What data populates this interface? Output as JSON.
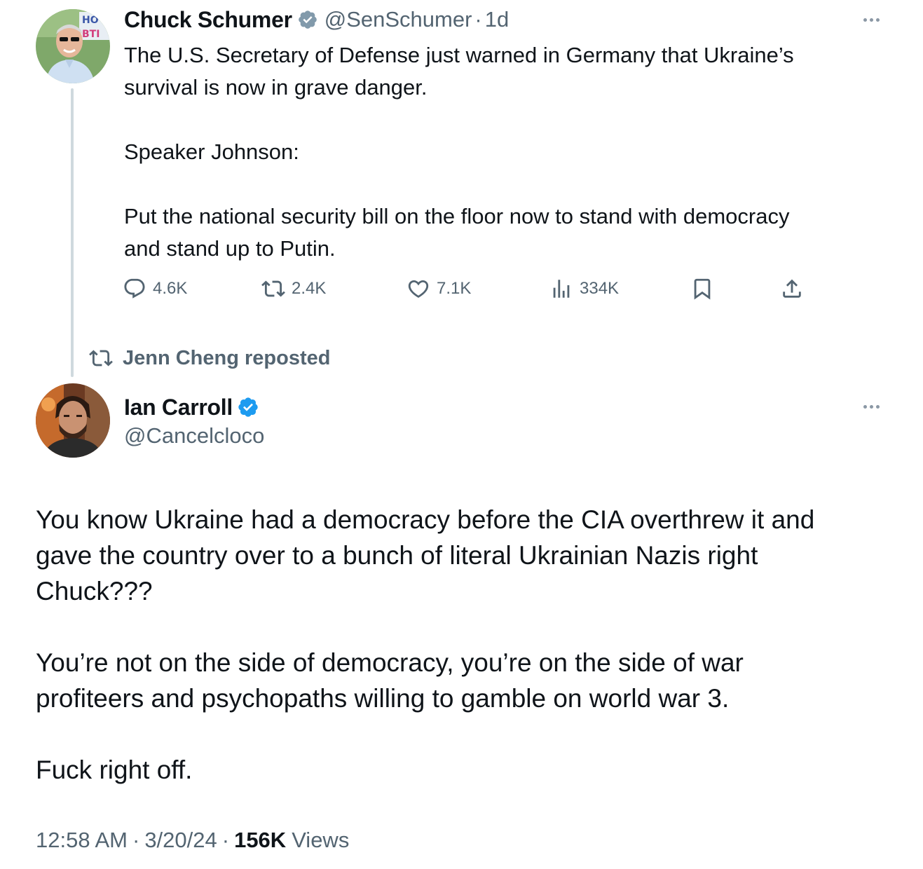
{
  "tweet1": {
    "author_name": "Chuck Schumer",
    "handle": "@SenSchumer",
    "separator": "·",
    "time": "1d",
    "badge_icon": "verified-government-badge",
    "text": "The U.S. Secretary of Defense just warned in Germany that Ukraine’s\nsurvival is now in grave danger.\n\nSpeaker Johnson:\n\nPut the national security bill on the floor now to stand with democracy\nand stand up to Putin.",
    "actions": {
      "replies": "4.6K",
      "reposts": "2.4K",
      "likes": "7.1K",
      "views": "334K"
    }
  },
  "repost_label": "Jenn Cheng reposted",
  "tweet2": {
    "author_name": "Ian Carroll",
    "handle": "@Cancelcloco",
    "badge_icon": "verified-blue-badge",
    "text": "You know Ukraine had a democracy before the CIA overthrew it and\ngave the country over to a bunch of literal Ukrainian Nazis right\nChuck???\n\nYou’re not on the side of democracy, you’re on the side of war\nprofiteers and psychopaths willing to gamble on world war 3.\n\nFuck right off.",
    "footer": {
      "time": "12:58 AM",
      "sep1": "·",
      "date": "3/20/24",
      "sep2": "·",
      "views_count": "156K",
      "views_label": "Views"
    }
  },
  "colors": {
    "text_primary": "#0f1419",
    "text_secondary": "#536471",
    "verified_blue": "#1d9bf0",
    "verified_gray": "#829aab",
    "thread_line": "#cfd9de"
  }
}
